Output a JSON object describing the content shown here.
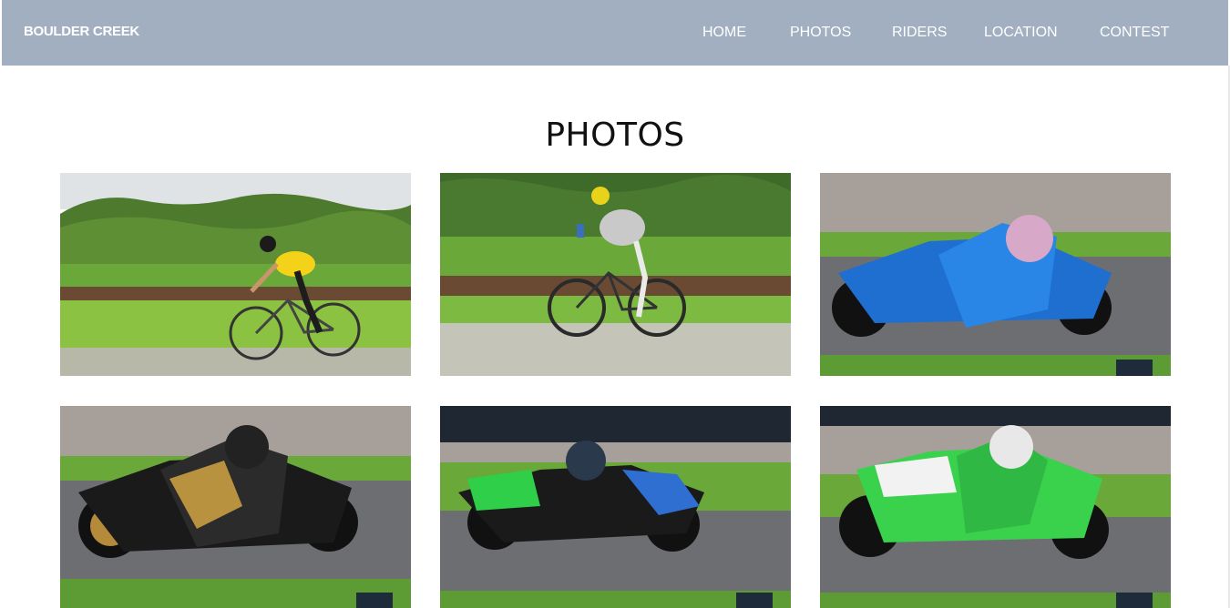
{
  "header": {
    "brand": "BOULDER CREEK",
    "nav": [
      "HOME",
      "PHOTOS",
      "RIDERS",
      "LOCATION",
      "CONTEST"
    ]
  },
  "main": {
    "title": "PHOTOS",
    "photos": [
      {
        "subject": "road cyclist in yellow and black kit",
        "watermark": ""
      },
      {
        "subject": "road cyclist in grey jacket holding bottle",
        "watermark": ""
      },
      {
        "subject": "blue motorcycle racer leaning into corner",
        "watermark": "NCR"
      },
      {
        "subject": "black and gold motorcycle racer leaning into corner",
        "watermark": "NCR"
      },
      {
        "subject": "green and black motorcycle racer on track",
        "watermark": "NCR"
      },
      {
        "subject": "green and white motorcycle racer leaning into corner",
        "watermark": "NCR"
      }
    ]
  },
  "colors": {
    "navbar": "#a1afc0",
    "grass": "#6aa83a",
    "track": "#6d6e72"
  }
}
